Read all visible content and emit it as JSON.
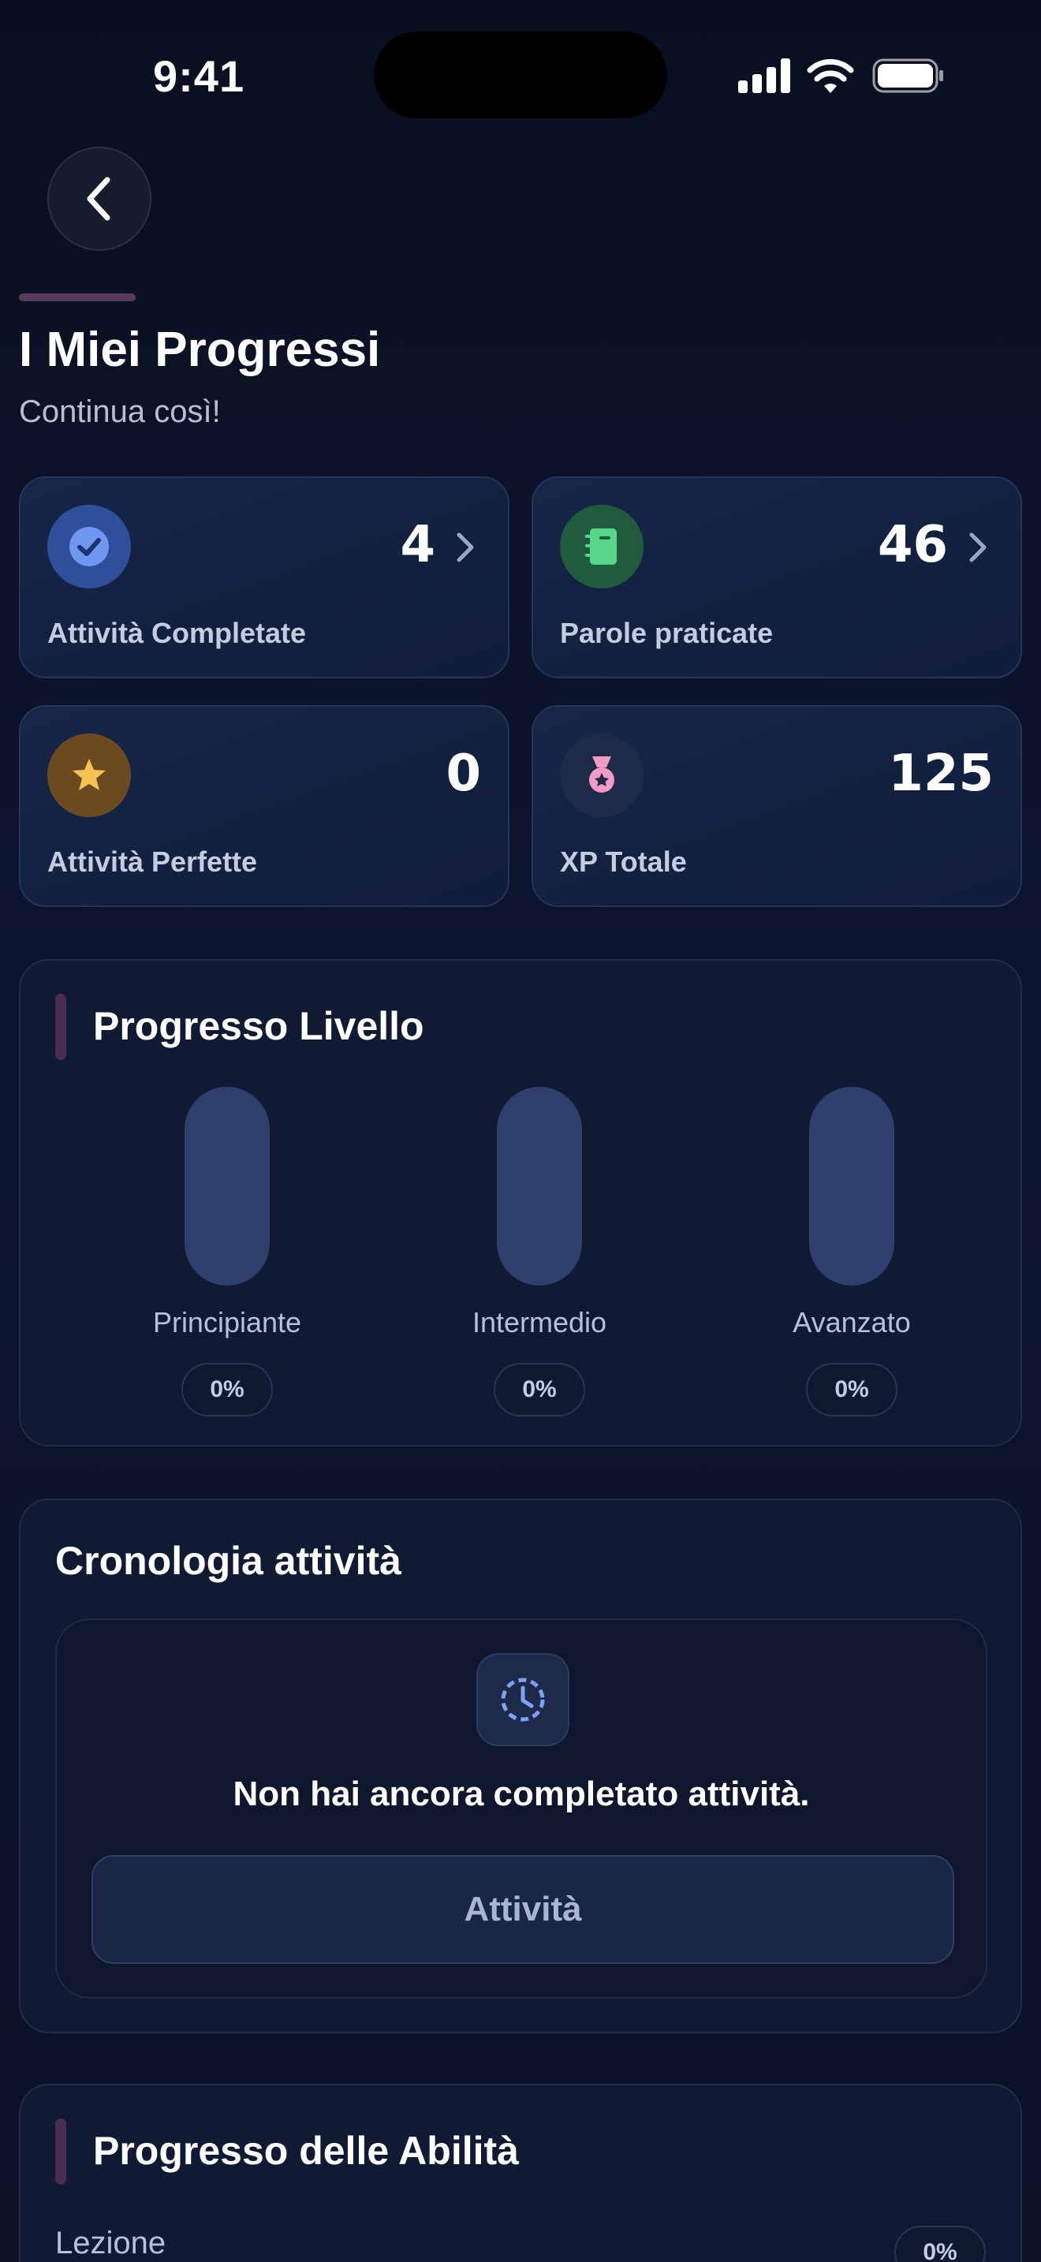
{
  "status_bar": {
    "time": "9:41"
  },
  "header": {
    "title": "I Miei Progressi",
    "subtitle": "Continua così!"
  },
  "stats": [
    {
      "value": "4",
      "label": "Attività Completate",
      "icon": "check-circle-icon",
      "color": "#5b82e0"
    },
    {
      "value": "46",
      "label": "Parole praticate",
      "icon": "notebook-icon",
      "color": "#3fbf6b"
    },
    {
      "value": "0",
      "label": "Attività Perfette",
      "icon": "star-icon",
      "color": "#f0b448"
    },
    {
      "value": "125",
      "label": "XP Totale",
      "icon": "medal-icon",
      "color": "#f29bc4"
    }
  ],
  "level_progress": {
    "title": "Progresso Livello",
    "levels": [
      {
        "label": "Principiante",
        "percent": "0%"
      },
      {
        "label": "Intermedio",
        "percent": "0%"
      },
      {
        "label": "Avanzato",
        "percent": "0%"
      }
    ]
  },
  "history": {
    "title": "Cronologia attività",
    "empty_text": "Non hai ancora completato attività.",
    "button_label": "Attività"
  },
  "skills": {
    "title": "Progresso delle Abilità",
    "rows": [
      {
        "label": "Lezione",
        "percent": "0%"
      }
    ]
  }
}
